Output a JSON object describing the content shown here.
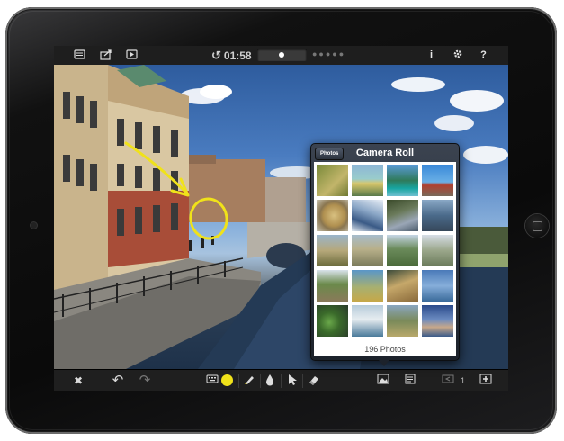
{
  "app": {
    "top_toolbar": {
      "left_icons": [
        "list-icon",
        "share-icon",
        "play-icon"
      ],
      "timer": "01:58",
      "right_icons": [
        "info-icon",
        "gear-icon",
        "help-icon"
      ]
    },
    "popover": {
      "back_label": "Photos",
      "title": "Camera Roll",
      "photo_count": "196 Photos"
    },
    "bottom_toolbar": {
      "page_number": "1"
    },
    "annotation": {
      "stroke_color": "#f0e21a"
    }
  },
  "glyphs": {
    "info": "i",
    "help": "?",
    "undo": "↺",
    "close": "✖",
    "undo_arrow": "↶",
    "redo_arrow": "↷"
  }
}
